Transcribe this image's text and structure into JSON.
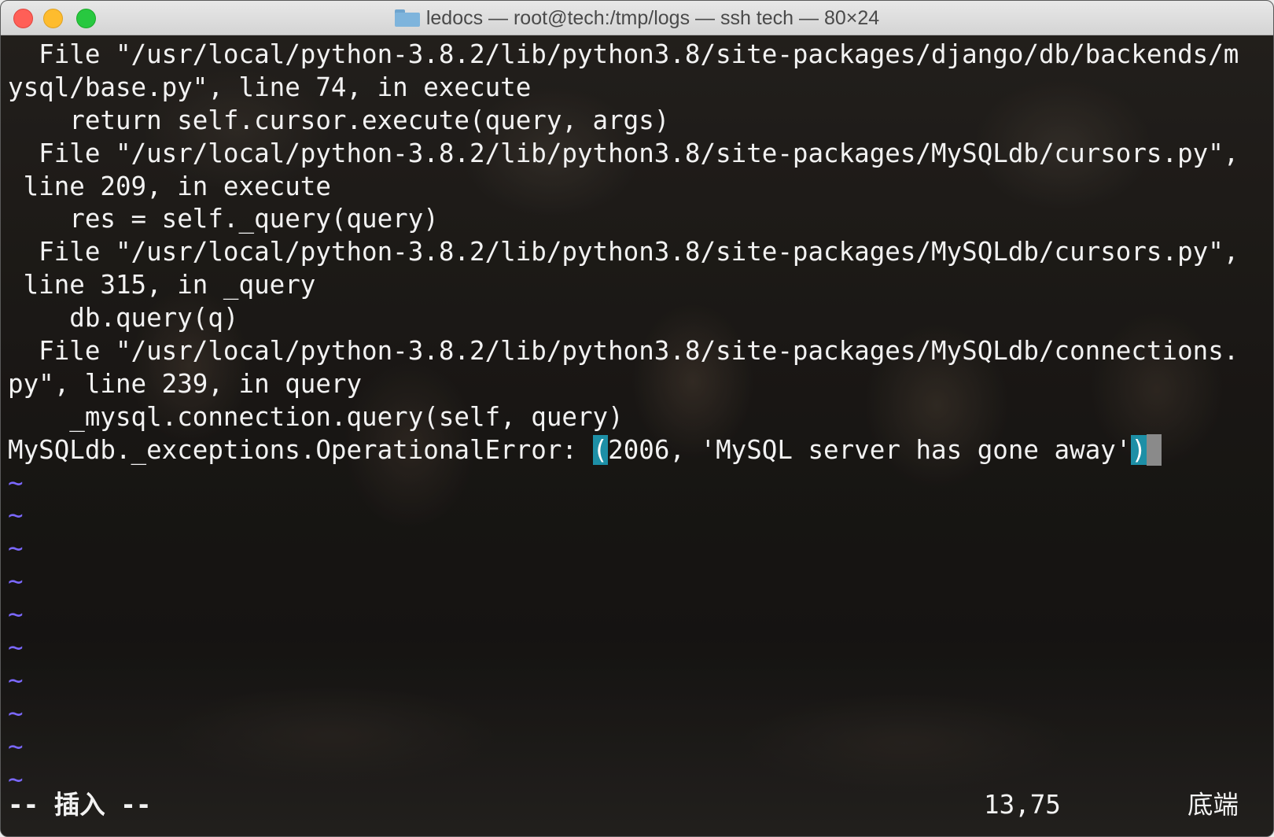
{
  "window": {
    "title": "ledocs — root@tech:/tmp/logs — ssh tech — 80×24",
    "controls": [
      "close",
      "minimize",
      "maximize"
    ],
    "title_icon": "folder-icon"
  },
  "terminal": {
    "lines": [
      "  File \"/usr/local/python-3.8.2/lib/python3.8/site-packages/django/db/backends/m",
      "ysql/base.py\", line 74, in execute",
      "    return self.cursor.execute(query, args)",
      "  File \"/usr/local/python-3.8.2/lib/python3.8/site-packages/MySQLdb/cursors.py\",",
      " line 209, in execute",
      "    res = self._query(query)",
      "  File \"/usr/local/python-3.8.2/lib/python3.8/site-packages/MySQLdb/cursors.py\",",
      " line 315, in _query",
      "    db.query(q)",
      "  File \"/usr/local/python-3.8.2/lib/python3.8/site-packages/MySQLdb/connections.",
      "py\", line 239, in query",
      "    _mysql.connection.query(self, query)"
    ],
    "error_line": {
      "prefix": "MySQLdb._exceptions.OperationalError: ",
      "open_paren": "(",
      "message": "2006, 'MySQL server has gone away'",
      "close_paren": ")"
    },
    "tilde_char": "~",
    "tilde_count": 10,
    "colors": {
      "text": "#f2f2f2",
      "tilde": "#7b68ff",
      "match_highlight": "#1d8fa6",
      "cursor": "#8a8a8a"
    }
  },
  "statusbar": {
    "mode": "-- 插入 --",
    "position": "13,75",
    "scroll": "底端"
  }
}
